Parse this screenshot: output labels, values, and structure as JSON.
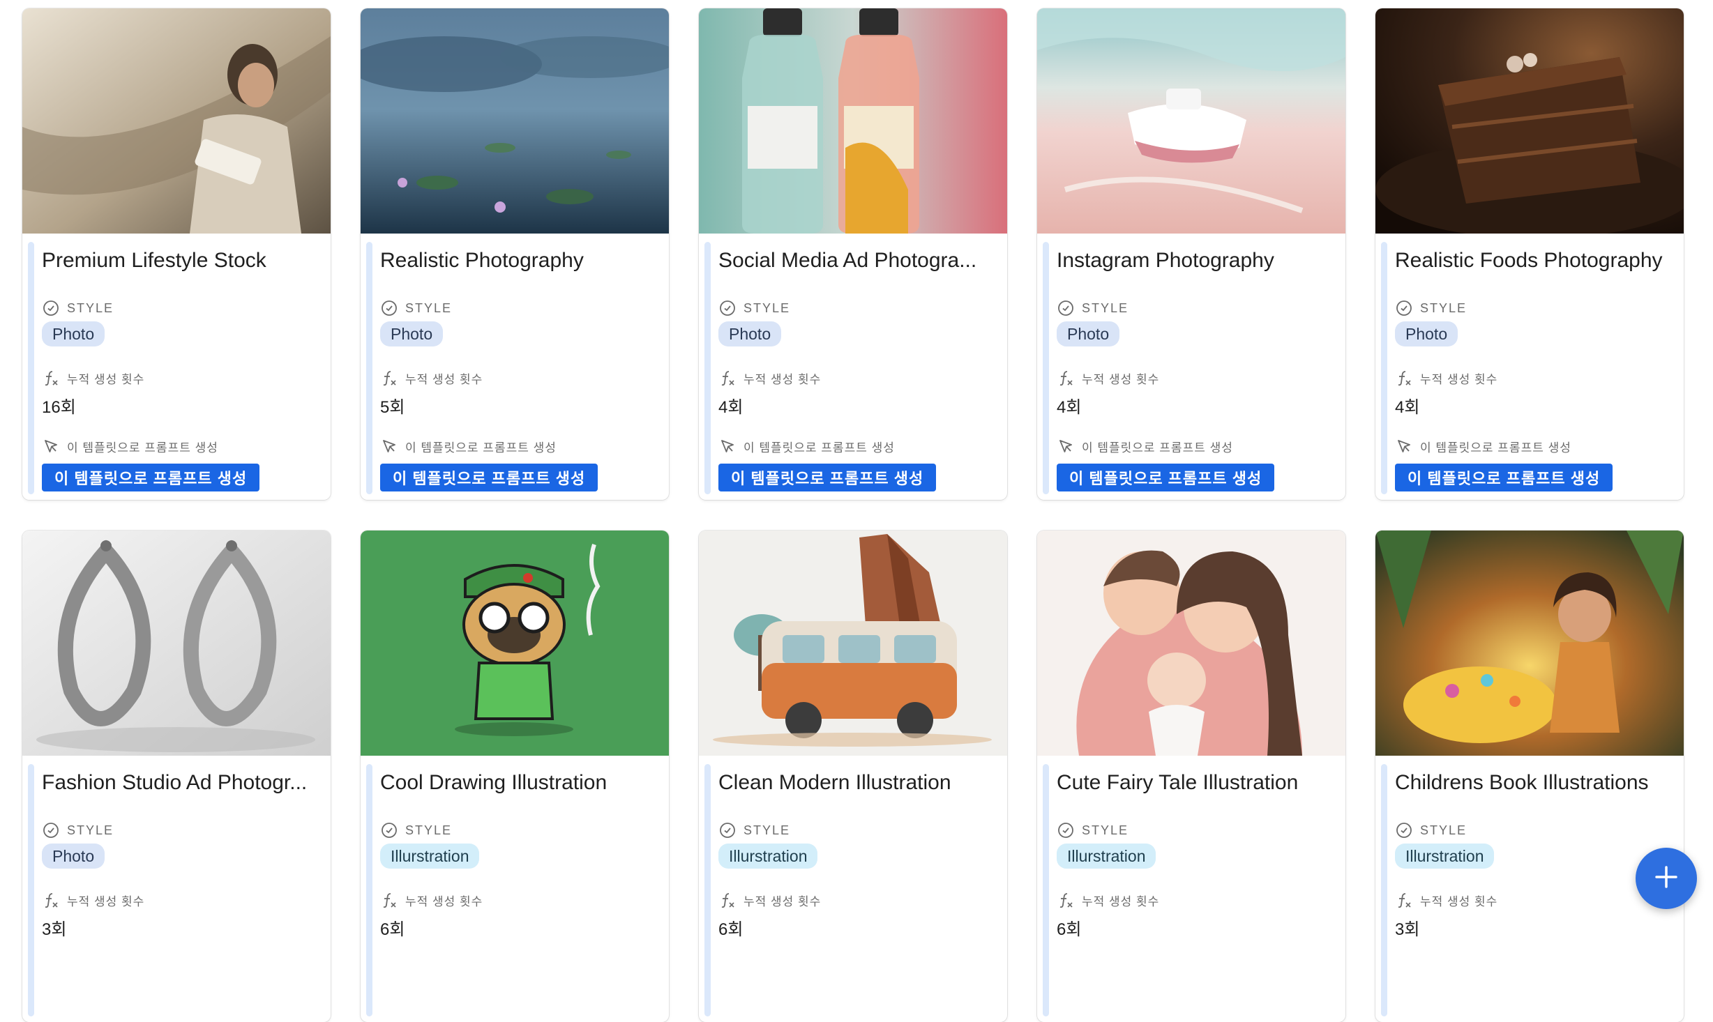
{
  "labels": {
    "style": "STYLE",
    "count": "누적 생성 횟수",
    "generate_hint": "이 템플릿으로 프롬프트 생성",
    "generate_button": "이 템플릿으로 프롬프트 생성"
  },
  "cards": [
    {
      "title": "Premium Lifestyle Stock",
      "tag": "Photo",
      "count": "16회"
    },
    {
      "title": "Realistic Photography",
      "tag": "Photo",
      "count": "5회"
    },
    {
      "title": "Social Media Ad Photogra...",
      "tag": "Photo",
      "count": "4회"
    },
    {
      "title": "Instagram Photography",
      "tag": "Photo",
      "count": "4회"
    },
    {
      "title": "Realistic Foods Photography",
      "tag": "Photo",
      "count": "4회"
    },
    {
      "title": "Fashion Studio Ad Photogr...",
      "tag": "Photo",
      "count": "3회"
    },
    {
      "title": "Cool Drawing Illustration",
      "tag": "Illurstration",
      "count": "6회"
    },
    {
      "title": "Clean Modern Illustration",
      "tag": "Illurstration",
      "count": "6회"
    },
    {
      "title": "Cute Fairy Tale Illustration",
      "tag": "Illurstration",
      "count": "6회"
    },
    {
      "title": "Childrens Book Illustrations",
      "tag": "Illurstration",
      "count": "3회"
    }
  ],
  "icons": {
    "style": "check-circle-icon",
    "count": "formula-icon",
    "generate": "cursor-icon",
    "fab": "plus-icon"
  },
  "colors": {
    "button": "#1a66e4",
    "fab": "#2e6fe0",
    "photo_tag": "#d9e4f7",
    "illustration_tag": "#d3eefa"
  }
}
